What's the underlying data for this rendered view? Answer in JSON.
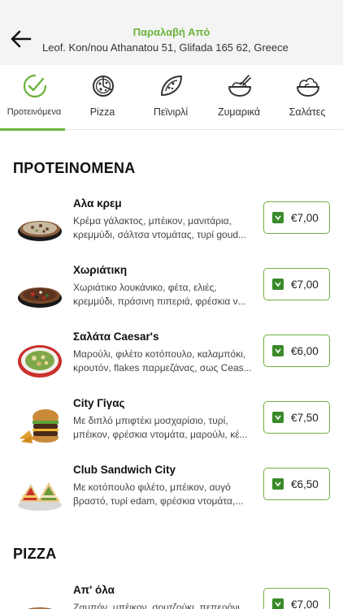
{
  "header": {
    "title": "Παραλαβή Από",
    "address": "Leof. Kon/nou Athanatou 51, Glifada 165 62, Greece"
  },
  "tabs": [
    {
      "label": "Προτεινόμενα",
      "icon": "check-circle-icon",
      "active": true
    },
    {
      "label": "Pizza",
      "icon": "pizza-icon",
      "active": false
    },
    {
      "label": "Πεϊνιρλί",
      "icon": "peinirli-icon",
      "active": false
    },
    {
      "label": "Ζυμαρικά",
      "icon": "pasta-bowl-icon",
      "active": false
    },
    {
      "label": "Σαλάτες",
      "icon": "salad-bowl-icon",
      "active": false
    }
  ],
  "sections": [
    {
      "title": "ΠΡΟΤΕΙΝΟΜΕΝΑ",
      "items": [
        {
          "name": "Αλα κρεμ",
          "desc1": "Κρέμα γάλακτος, μπέικον, μανιτάρια,",
          "desc2": "κρεμμύδι, σάλτσα ντομάτας, τυρί goud...",
          "price": "€7,00",
          "image": "pizza"
        },
        {
          "name": "Χωριάτικη",
          "desc1": "Χωριάτικο λουκάνικο, φέτα, ελιές,",
          "desc2": "κρεμμύδι, πράσινη πιπεριά, φρέσκια ν...",
          "price": "€7,00",
          "image": "pizza"
        },
        {
          "name": "Σαλάτα Caesar's",
          "desc1": "Μαρούλι, φιλέτο κοτόπουλο, καλαμπόκι,",
          "desc2": "κρουτόν, flakes παρμεζάνας, σως Ceas...",
          "price": "€6,00",
          "image": "salad"
        },
        {
          "name": "City Γίγας",
          "desc1": " Με διπλό μπιφτέκι μοσχαρίσιο, τυρί,",
          "desc2": "μπέικον, φρέσκια ντομάτα, μαρούλι, κέ...",
          "price": "€7,50",
          "image": "burger"
        },
        {
          "name": "Club Sandwich City",
          "desc1": "Με κοτόπουλο φιλέτο, μπέικον, αυγό",
          "desc2": "βραστό, τυρί edam, φρέσκια ντομάτα,...",
          "price": "€6,50",
          "image": "club-sandwich"
        }
      ]
    },
    {
      "title": "PIZZA",
      "items": [
        {
          "name": "Απ' όλα",
          "desc1": "Ζαμπόν, μπέικον, σουτζούκι, πεπερόνι,",
          "desc2": "",
          "price": "€7,00",
          "image": "pizza"
        }
      ]
    }
  ],
  "colors": {
    "accent": "#6cb33e",
    "cart": "#3a8a2a"
  }
}
